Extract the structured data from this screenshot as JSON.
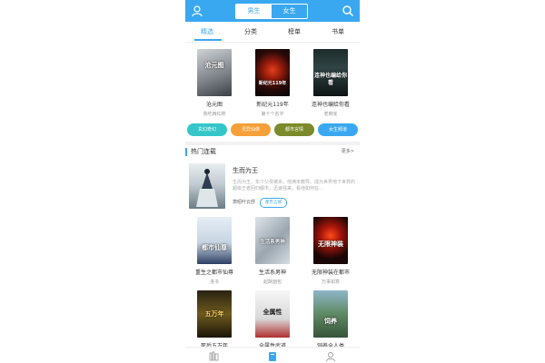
{
  "header": {
    "gender_tabs": [
      "男生",
      "女生"
    ],
    "active_gender": "男生",
    "accent": "#3aa8f0"
  },
  "tabs": [
    {
      "label": "精选",
      "active": true
    },
    {
      "label": "分类",
      "active": false
    },
    {
      "label": "榜单",
      "active": false
    },
    {
      "label": "书单",
      "active": false
    }
  ],
  "top_books": [
    {
      "title": "沧元图",
      "author": "我吃西红柿",
      "cover_text": "沧元图"
    },
    {
      "title": "新纪元119年",
      "author": "第十个名字",
      "cover_text": "新纪元119年"
    },
    {
      "title": "连神也编给你看",
      "author": "老麻雀",
      "cover_text": "连神也编给你看"
    }
  ],
  "categories": [
    {
      "label": "玄幻奇幻",
      "color": "#35c6c9"
    },
    {
      "label": "灵异仙侠",
      "color": "#f5a038"
    },
    {
      "label": "都市言情",
      "color": "#7b8a2a"
    },
    {
      "label": "女生频道",
      "color": "#3aa8f0"
    }
  ],
  "hot_section": {
    "title": "热门连载",
    "more": "更多>"
  },
  "featured": {
    "title": "生而为王",
    "description": "生而为王。年少父母被杀，他满未教导。成为世界地下世界的超级王者回归都市，迅速强来，看他如何在...",
    "author": "萧昭叶云舒",
    "tag": "都市言情"
  },
  "grid_row1": [
    {
      "title": "重生之都市仙尊",
      "author": "洛书",
      "cover_text": "都市仙尊"
    },
    {
      "title": "生活系男神",
      "author": "起酥面包",
      "cover_text": "生活系男神"
    },
    {
      "title": "无限神装在都市",
      "author": "万事如意",
      "cover_text": "无限神装"
    }
  ],
  "grid_row2": [
    {
      "title": "死后五万年",
      "author": "",
      "cover_text": "五万年"
    },
    {
      "title": "全属性武道",
      "author": "",
      "cover_text": "全属性"
    },
    {
      "title": "饲养全人类",
      "author": "",
      "cover_text": "饲养"
    }
  ],
  "bottom_nav": [
    {
      "icon": "bookshelf-icon",
      "active": false
    },
    {
      "icon": "book-city-icon",
      "active": true
    },
    {
      "icon": "profile-icon",
      "active": false
    }
  ]
}
